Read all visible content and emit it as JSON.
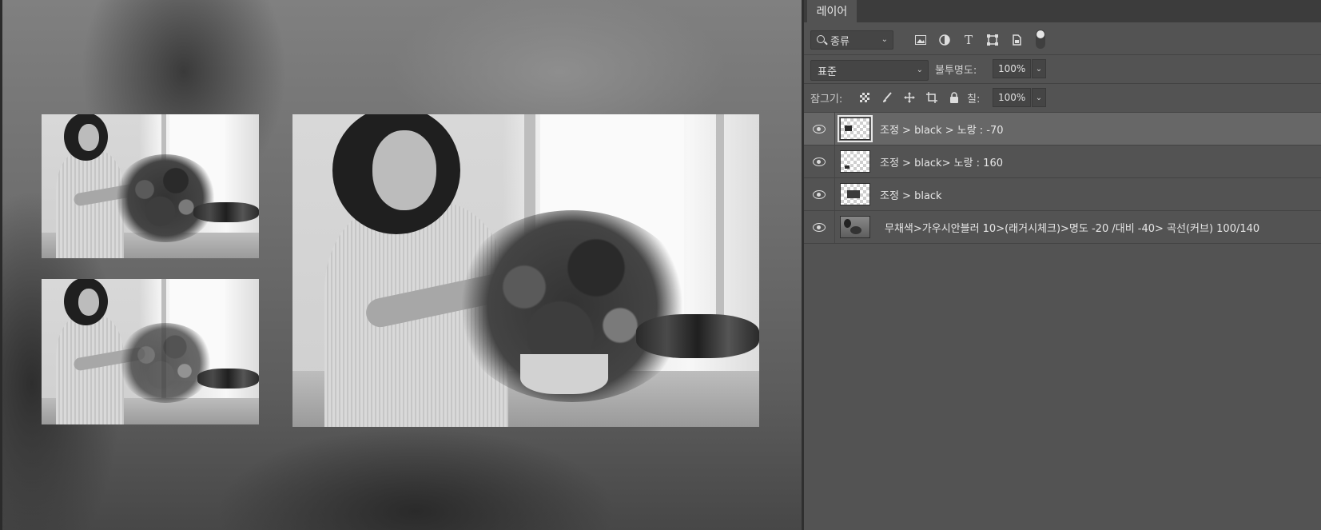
{
  "panel": {
    "tab_label": "레이어",
    "kind_filter": "종류",
    "blend_mode": "표준",
    "opacity_label": "불투명도:",
    "opacity_value": "100%",
    "lock_label": "잠그기:",
    "fill_label": "칠:",
    "fill_value": "100%",
    "filter_icons": [
      "image-filter-icon",
      "adjustment-filter-icon",
      "type-filter-icon",
      "shape-filter-icon",
      "smart-object-filter-icon"
    ],
    "lock_icons": [
      "lock-transparent-icon",
      "lock-paint-icon",
      "lock-position-icon",
      "lock-artboard-icon",
      "lock-all-icon"
    ]
  },
  "layers": [
    {
      "name": "조정 > black > 노랑 : -70",
      "selected": true,
      "thumb": "mask"
    },
    {
      "name": "조정 > black> 노랑 : 160",
      "selected": false,
      "thumb": "mask"
    },
    {
      "name": "조정 > black",
      "selected": false,
      "thumb": "mask"
    },
    {
      "name": "무채색>가우시안블러 10>(래거시체크)>명도 -20 /대비 -40> 곡선(커브) 100/140",
      "selected": false,
      "thumb": "photo"
    }
  ],
  "colors": {
    "panel_bg": "#535353",
    "selected_row": "#676767",
    "tab_bar": "#3c3c3c"
  }
}
